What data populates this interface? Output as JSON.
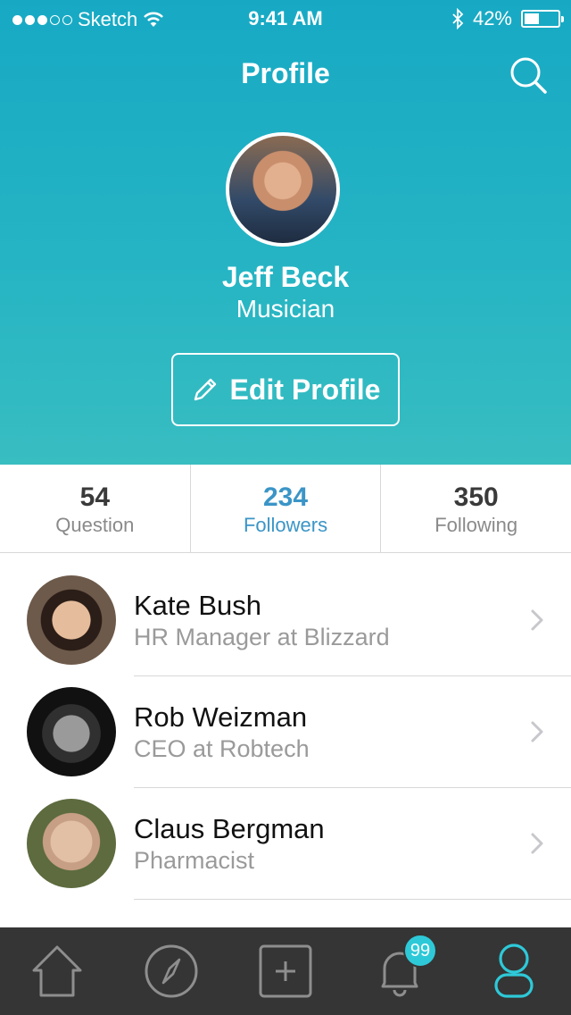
{
  "status_bar": {
    "carrier": "Sketch",
    "time": "9:41 AM",
    "battery": "42%",
    "battery_level": 0.42
  },
  "header": {
    "title": "Profile",
    "search_icon": "search-icon"
  },
  "profile": {
    "name": "Jeff Beck",
    "role": "Musician",
    "edit_label": "Edit Profile"
  },
  "stats": [
    {
      "value": "54",
      "label": "Question",
      "active": false
    },
    {
      "value": "234",
      "label": "Followers",
      "active": true
    },
    {
      "value": "350",
      "label": "Following",
      "active": false
    }
  ],
  "people": [
    {
      "name": "Kate Bush",
      "subtitle": "HR Manager at Blizzard"
    },
    {
      "name": "Rob Weizman",
      "subtitle": "CEO at Robtech"
    },
    {
      "name": "Claus Bergman",
      "subtitle": "Pharmacist"
    }
  ],
  "tabbar": {
    "tabs": [
      "home-icon",
      "compass-icon",
      "add-icon",
      "bell-icon",
      "profile-icon"
    ],
    "notification_badge": "99",
    "active_tab": "profile-icon"
  },
  "colors": {
    "accent": "#2ec9d8",
    "header_gradient_top": "#17a9c4",
    "header_gradient_bottom": "#38bdc1",
    "active_stat": "#3b95c7",
    "tabbar_bg": "#353535"
  }
}
